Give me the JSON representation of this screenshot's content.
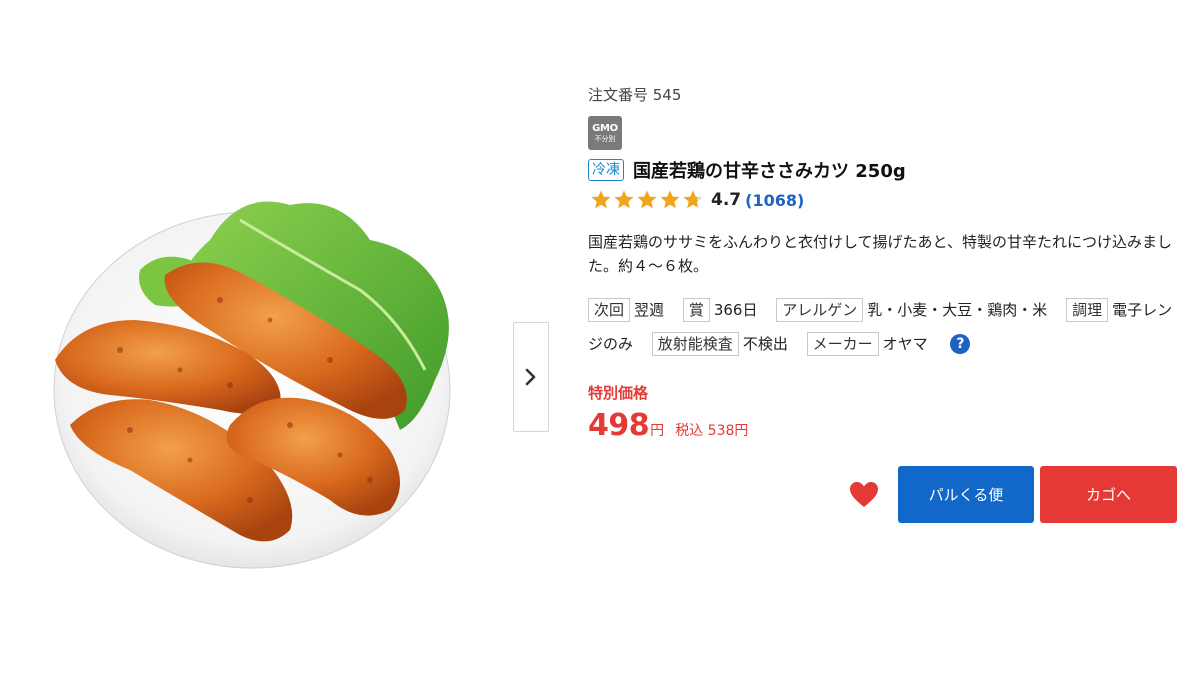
{
  "product": {
    "order_number_label": "注文番号 545",
    "gmo_badge": {
      "line1": "GMO",
      "line2": "不分別"
    },
    "frozen_badge": "冷凍",
    "title": "国産若鶏の甘辛ささみカツ 250g",
    "rating": {
      "value": "4.7",
      "review_count": "(1068)",
      "stars_filled": 4.7,
      "stars_max": 5
    },
    "description": "国産若鶏のササミをふんわりと衣付けして揚げたあと、特製の甘辛たれにつけ込みました。約４～６枚。",
    "attributes": [
      {
        "label": "次回",
        "value": "翌週"
      },
      {
        "label": "賞",
        "value": "366日"
      },
      {
        "label": "アレルゲン",
        "value": "乳・小麦・大豆・鶏肉・米"
      },
      {
        "label": "調理",
        "value": "電子レンジのみ"
      },
      {
        "label": "放射能検査",
        "value": "不検出"
      },
      {
        "label": "メーカー",
        "value": "オヤマ"
      }
    ],
    "help_icon": "?",
    "price": {
      "special_label": "特別価格",
      "amount": "498",
      "unit": "円",
      "tax_included": "税込 538円"
    }
  },
  "actions": {
    "favorite_icon": "heart-icon",
    "pal_button_label": "パルくる便",
    "cart_button_label": "カゴへ"
  },
  "gallery": {
    "next_icon": "chevron-right-icon"
  },
  "colors": {
    "accent_red": "#e53935",
    "accent_blue": "#1168c9",
    "link_blue": "#1e63c4",
    "frozen_blue": "#1e88c8",
    "star_gold": "#f0a51c"
  }
}
